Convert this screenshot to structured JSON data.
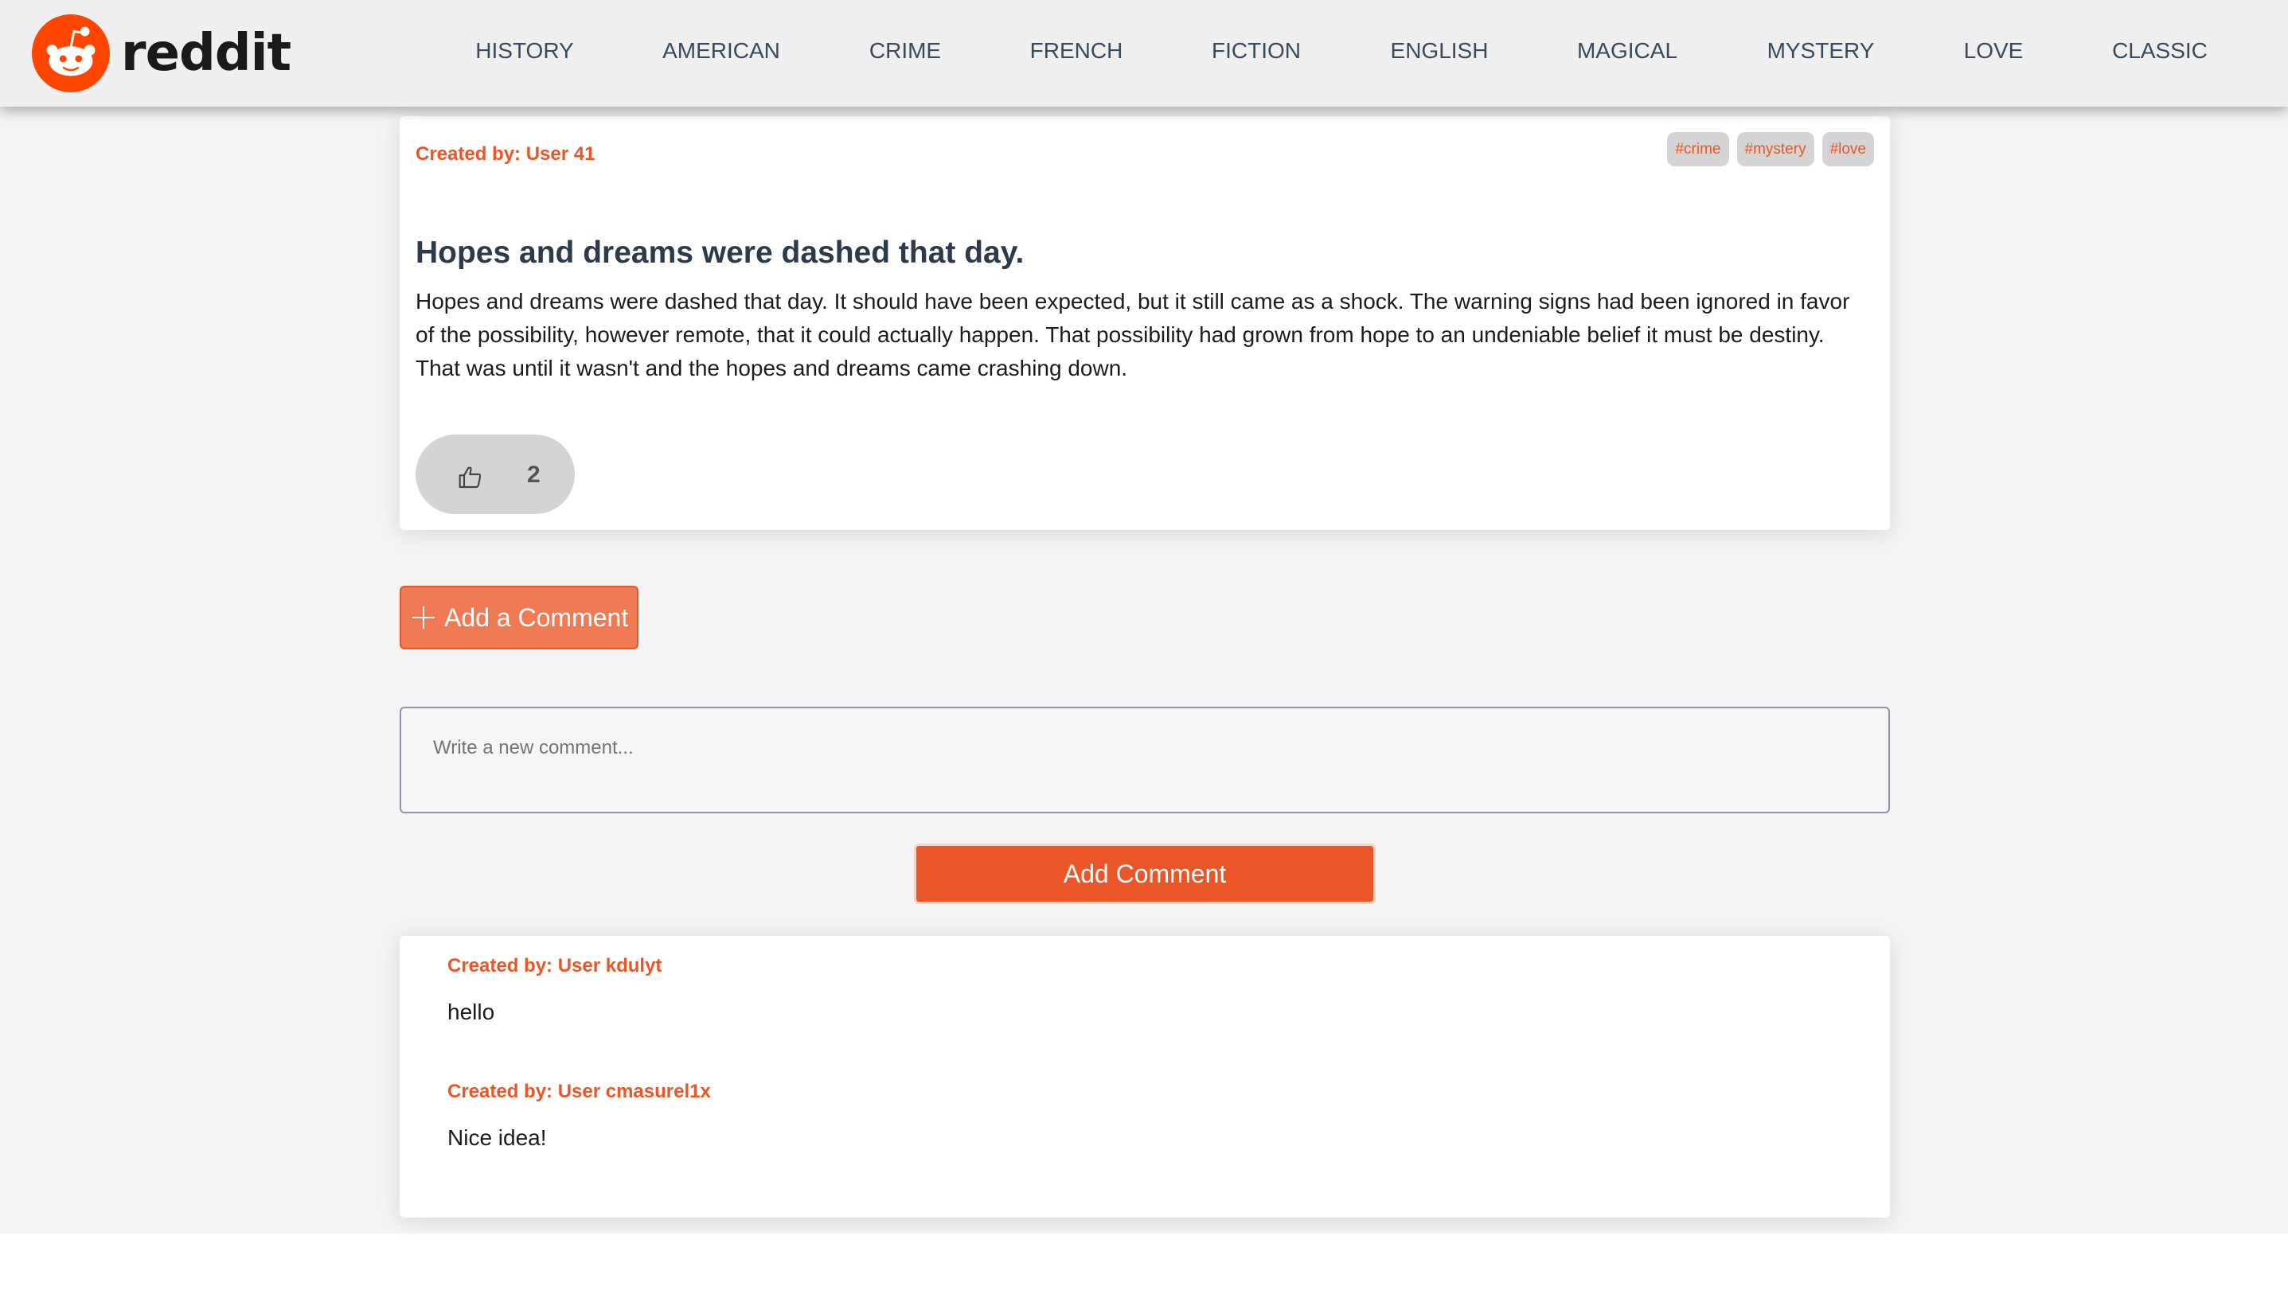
{
  "app": {
    "brand": "reddit",
    "colors": {
      "accent": "#ea5628",
      "header_bg": "#efefef",
      "page_bg": "#f4f4f4",
      "tag_bg": "#d4d4d4"
    }
  },
  "nav": {
    "items": [
      {
        "label": "HISTORY"
      },
      {
        "label": "AMERICAN"
      },
      {
        "label": "CRIME"
      },
      {
        "label": "FRENCH"
      },
      {
        "label": "FICTION"
      },
      {
        "label": "ENGLISH"
      },
      {
        "label": "MAGICAL"
      },
      {
        "label": "MYSTERY"
      },
      {
        "label": "LOVE"
      },
      {
        "label": "CLASSIC"
      }
    ]
  },
  "post": {
    "author": "Created by: User 41",
    "tags": [
      "#crime",
      "#mystery",
      "#love"
    ],
    "title": "Hopes and dreams were dashed that day.",
    "body": "Hopes and dreams were dashed that day. It should have been expected, but it still came as a shock. The warning signs had been ignored in favor of the possibility, however remote, that it could actually happen. That possibility had grown from hope to an undeniable belief it must be destiny. That was until it wasn't and the hopes and dreams came crashing down.",
    "likes": "2",
    "like_icon": "thumbs-up-icon"
  },
  "comment_form": {
    "toggle_label": "Add a Comment",
    "toggle_icon": "plus-icon",
    "placeholder": "Write a new comment...",
    "value": "",
    "submit_label": "Add Comment"
  },
  "comments": [
    {
      "author": "Created by: User kdulyt",
      "text": "hello"
    },
    {
      "author": "Created by: User cmasurel1x",
      "text": "Nice idea!"
    }
  ]
}
